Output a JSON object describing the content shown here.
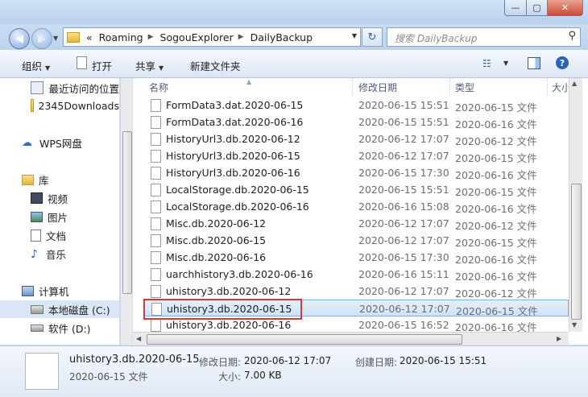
{
  "window": {
    "controls": {
      "minimize": "—",
      "maximize": "▢",
      "close": "✕"
    }
  },
  "address": {
    "prefix": "«",
    "segments": [
      "Roaming",
      "SogouExplorer",
      "DailyBackup"
    ],
    "separator": "▶"
  },
  "search": {
    "placeholder": "搜索 DailyBackup"
  },
  "toolbar": {
    "organize": "组织",
    "open": "打开",
    "share": "共享",
    "new_folder": "新建文件夹"
  },
  "nav": {
    "items": [
      {
        "label": "最近访问的位置",
        "icon": "recent-places-icon"
      },
      {
        "label": "2345Downloads",
        "icon": "folder-icon"
      },
      {
        "label": "WPS网盘",
        "icon": "cloud-icon"
      },
      {
        "label": "库",
        "icon": "library-icon"
      },
      {
        "label": "视频",
        "icon": "video-icon"
      },
      {
        "label": "图片",
        "icon": "picture-icon"
      },
      {
        "label": "文档",
        "icon": "document-icon"
      },
      {
        "label": "音乐",
        "icon": "music-icon"
      },
      {
        "label": "计算机",
        "icon": "computer-icon"
      },
      {
        "label": "本地磁盘 (C:)",
        "icon": "drive-icon"
      },
      {
        "label": "软件 (D:)",
        "icon": "drive-icon"
      }
    ]
  },
  "columns": {
    "name": "名称",
    "date": "修改日期",
    "type": "类型",
    "size": "大小"
  },
  "files": [
    {
      "name": "FormData3.dat.2020-06-15",
      "date": "2020-06-15 15:51",
      "type": "2020-06-15 文件"
    },
    {
      "name": "FormData3.dat.2020-06-16",
      "date": "2020-06-15 15:51",
      "type": "2020-06-16 文件"
    },
    {
      "name": "HistoryUrl3.db.2020-06-12",
      "date": "2020-06-12 17:07",
      "type": "2020-06-12 文件"
    },
    {
      "name": "HistoryUrl3.db.2020-06-15",
      "date": "2020-06-12 17:07",
      "type": "2020-06-15 文件"
    },
    {
      "name": "HistoryUrl3.db.2020-06-16",
      "date": "2020-06-15 17:30",
      "type": "2020-06-16 文件"
    },
    {
      "name": "LocalStorage.db.2020-06-15",
      "date": "2020-06-15 15:51",
      "type": "2020-06-15 文件"
    },
    {
      "name": "LocalStorage.db.2020-06-16",
      "date": "2020-06-16 15:08",
      "type": "2020-06-16 文件"
    },
    {
      "name": "Misc.db.2020-06-12",
      "date": "2020-06-12 17:07",
      "type": "2020-06-12 文件"
    },
    {
      "name": "Misc.db.2020-06-15",
      "date": "2020-06-12 17:07",
      "type": "2020-06-15 文件"
    },
    {
      "name": "Misc.db.2020-06-16",
      "date": "2020-06-15 17:30",
      "type": "2020-06-16 文件"
    },
    {
      "name": "uarchhistory3.db.2020-06-16",
      "date": "2020-06-16 15:11",
      "type": "2020-06-16 文件"
    },
    {
      "name": "uhistory3.db.2020-06-12",
      "date": "2020-06-12 17:07",
      "type": "2020-06-12 文件"
    },
    {
      "name": "uhistory3.db.2020-06-15",
      "date": "2020-06-12 17:07",
      "type": "2020-06-15 文件"
    },
    {
      "name": "uhistory3.db.2020-06-16",
      "date": "2020-06-15 16:52",
      "type": "2020-06-16 文件"
    }
  ],
  "details": {
    "name": "uhistory3.db.2020-06-15",
    "type": "2020-06-15 文件",
    "modified_label": "修改日期:",
    "modified_value": "2020-06-12 17:07",
    "created_label": "创建日期:",
    "created_value": "2020-06-15 15:51",
    "size_label": "大小:",
    "size_value": "7.00 KB"
  },
  "colors": {
    "highlight_box": "#d23b3b",
    "selection": "#cde3f9"
  }
}
